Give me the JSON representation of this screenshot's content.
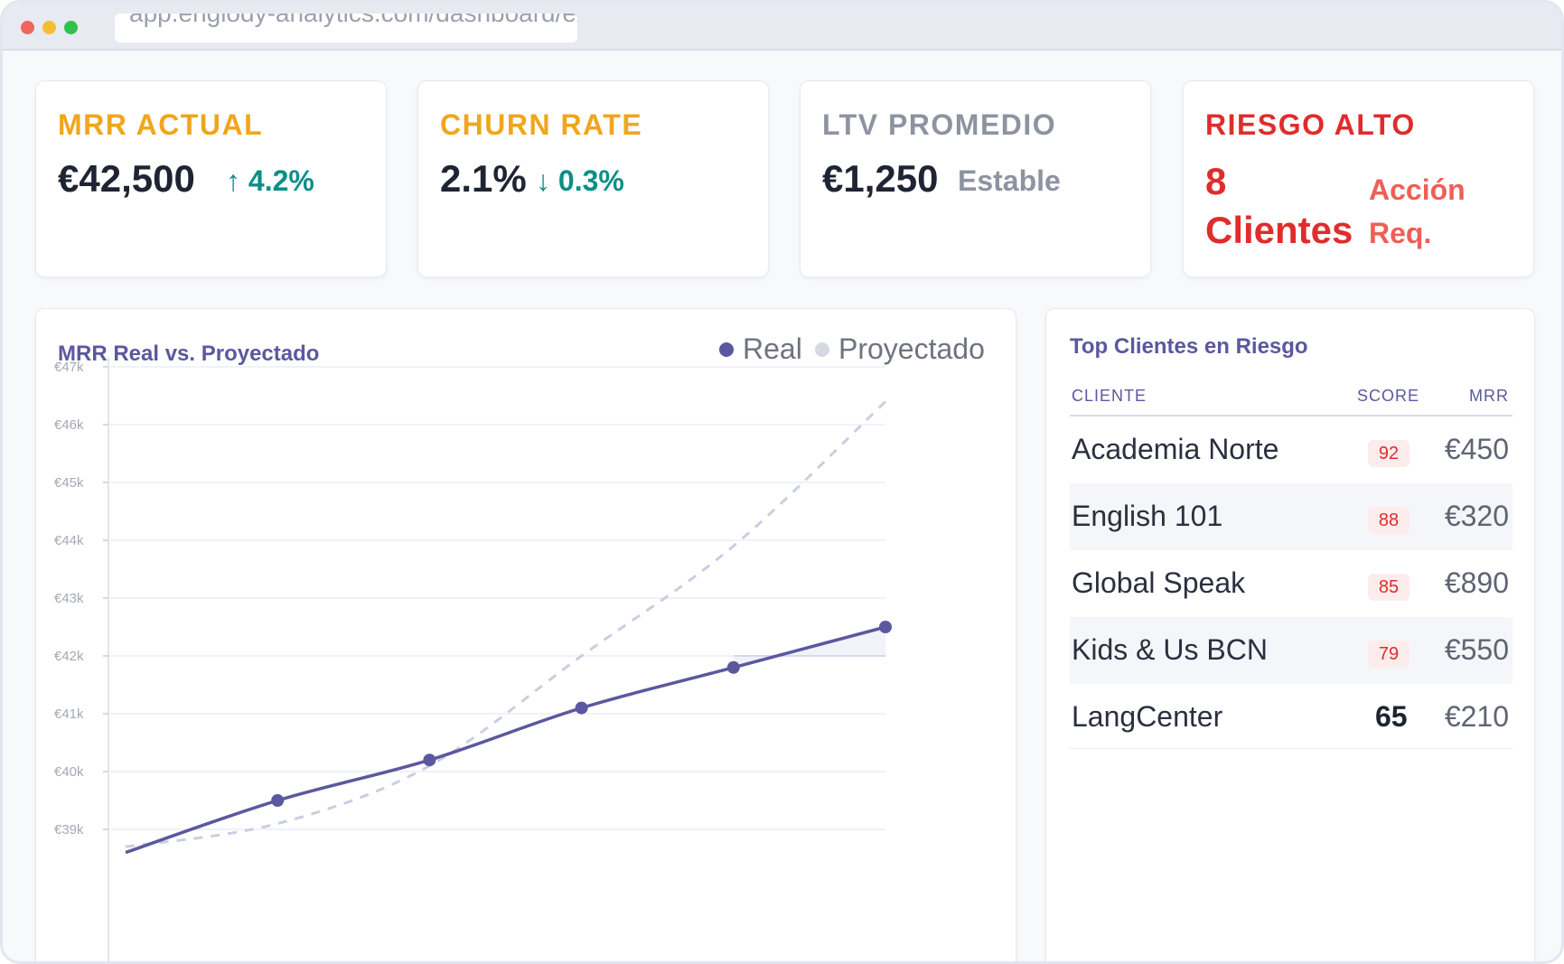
{
  "browser": {
    "url": "app.englody-analytics.com/dashboard/executive"
  },
  "kpis": {
    "mrr": {
      "title": "MRR ACTUAL",
      "value": "€42,500",
      "delta": "↑ 4.2%"
    },
    "churn": {
      "title": "CHURN RATE",
      "value": "2.1%",
      "delta": "↓ 0.3%"
    },
    "ltv": {
      "title": "LTV PROMEDIO",
      "value": "€1,250",
      "delta": "Estable"
    },
    "risk": {
      "title": "RIESGO ALTO",
      "value_line1": "8",
      "value_line2": "Clientes",
      "note_line1": "Acción",
      "note_line2": "Req."
    }
  },
  "chart": {
    "title": "MRR Real vs. Proyectado",
    "legend_real": "Real",
    "legend_projected": "Proyectado",
    "colors": {
      "real": "#5b589f",
      "projected": "#c9cfe0",
      "grid": "#eceef3"
    }
  },
  "chart_data": {
    "type": "line",
    "title": "MRR Real vs. Proyectado",
    "xlabel": "",
    "ylabel": "",
    "ylim": [
      38500,
      47000
    ],
    "y_ticks": [
      "€39k",
      "€40k",
      "€41k",
      "€42k",
      "€43k",
      "€44k",
      "€45k",
      "€46k",
      "€47k"
    ],
    "y_tick_values": [
      39000,
      40000,
      41000,
      42000,
      43000,
      44000,
      45000,
      46000,
      47000
    ],
    "legend": "top-right",
    "grid": true,
    "series": [
      {
        "name": "Real",
        "x": [
          0,
          1,
          2,
          3,
          4,
          5
        ],
        "values": [
          38600,
          39500,
          40200,
          41100,
          41800,
          42500
        ]
      },
      {
        "name": "Proyectado",
        "x": [
          0,
          1,
          2,
          3,
          4,
          5
        ],
        "values": [
          38700,
          39100,
          40100,
          42000,
          43900,
          46400
        ]
      }
    ]
  },
  "risk_table": {
    "title": "Top Clientes en Riesgo",
    "headers": {
      "client": "CLIENTE",
      "score": "SCORE",
      "mrr": "MRR"
    },
    "rows": [
      {
        "client": "Academia Norte",
        "score": "92",
        "mrr": "€450"
      },
      {
        "client": "English 101",
        "score": "88",
        "mrr": "€320"
      },
      {
        "client": "Global Speak",
        "score": "85",
        "mrr": "€890"
      },
      {
        "client": "Kids & Us BCN",
        "score": "79",
        "mrr": "€550"
      },
      {
        "client": "LangCenter",
        "score": "65",
        "mrr": "€210"
      }
    ]
  }
}
